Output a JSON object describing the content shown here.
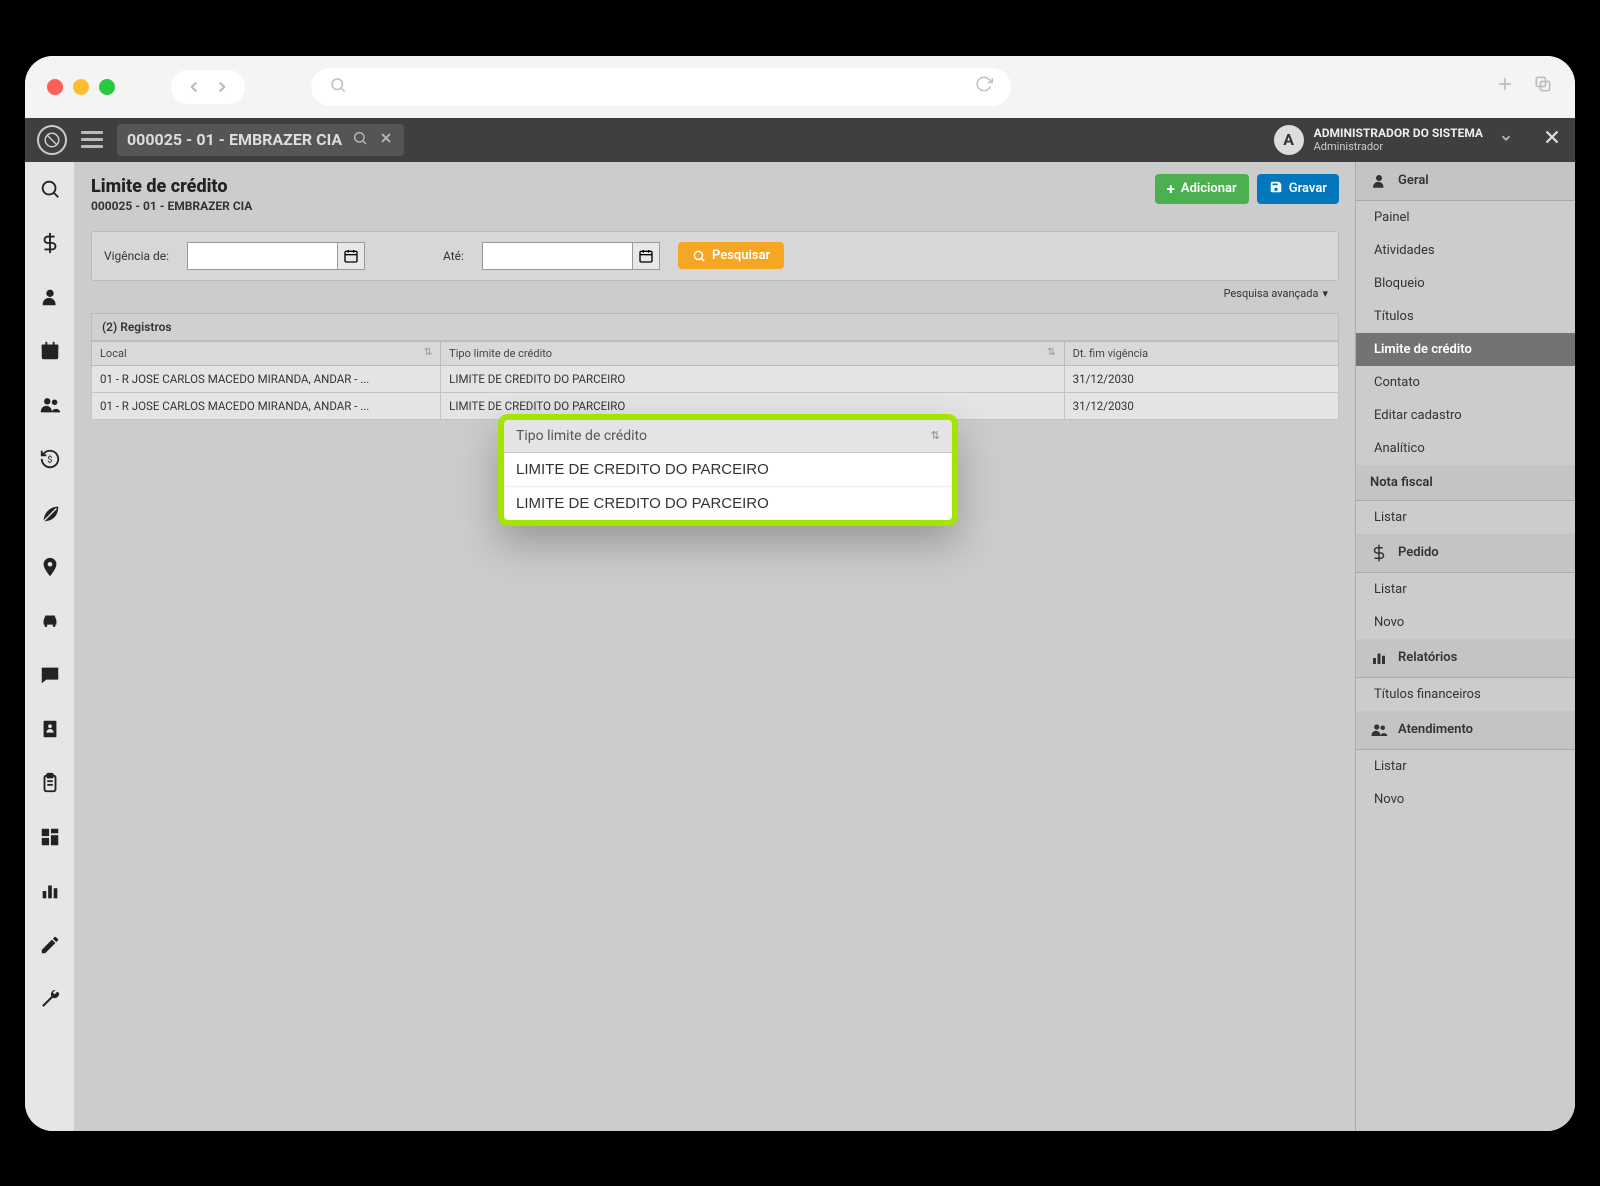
{
  "topbar": {
    "breadcrumb": "000025 - 01 - EMBRAZER CIA",
    "user_name": "ADMINISTRADOR DO SISTEMA",
    "user_role": "Administrador",
    "avatar_letter": "A"
  },
  "page": {
    "title": "Limite de crédito",
    "subtitle": "000025 - 01 - EMBRAZER CIA",
    "btn_add": "Adicionar",
    "btn_save": "Gravar"
  },
  "filter": {
    "label_from": "Vigência de:",
    "from_value": "",
    "label_to": "Até:",
    "to_value": "",
    "btn_search": "Pesquisar",
    "advanced": "Pesquisa avançada"
  },
  "table": {
    "count_label": "(2) Registros",
    "col_local": "Local",
    "col_tipo": "Tipo limite de crédito",
    "col_fim": "Dt. fim vigência",
    "rows": [
      {
        "local": "01 - R JOSE CARLOS MACEDO MIRANDA, ANDAR - ...",
        "tipo": "LIMITE DE CREDITO DO PARCEIRO",
        "fim": "31/12/2030"
      },
      {
        "local": "01 - R JOSE CARLOS MACEDO MIRANDA, ANDAR - ...",
        "tipo": "LIMITE DE CREDITO DO PARCEIRO",
        "fim": "31/12/2030"
      }
    ]
  },
  "highlight": {
    "header": "Tipo limite de crédito",
    "rows": [
      "LIMITE DE CREDITO DO PARCEIRO",
      "LIMITE DE CREDITO DO PARCEIRO"
    ]
  },
  "rightbar": {
    "sec_geral": "Geral",
    "geral_items": [
      "Painel",
      "Atividades",
      "Bloqueio",
      "Títulos",
      "Limite de crédito",
      "Contato",
      "Editar cadastro",
      "Analítico"
    ],
    "geral_active_index": 4,
    "sec_notafiscal": "Nota fiscal",
    "nf_items": [
      "Listar"
    ],
    "sec_pedido": "Pedido",
    "pedido_items": [
      "Listar",
      "Novo"
    ],
    "sec_relatorios": "Relatórios",
    "rel_items": [
      "Títulos financeiros"
    ],
    "sec_atendimento": "Atendimento",
    "at_items": [
      "Listar",
      "Novo"
    ]
  }
}
